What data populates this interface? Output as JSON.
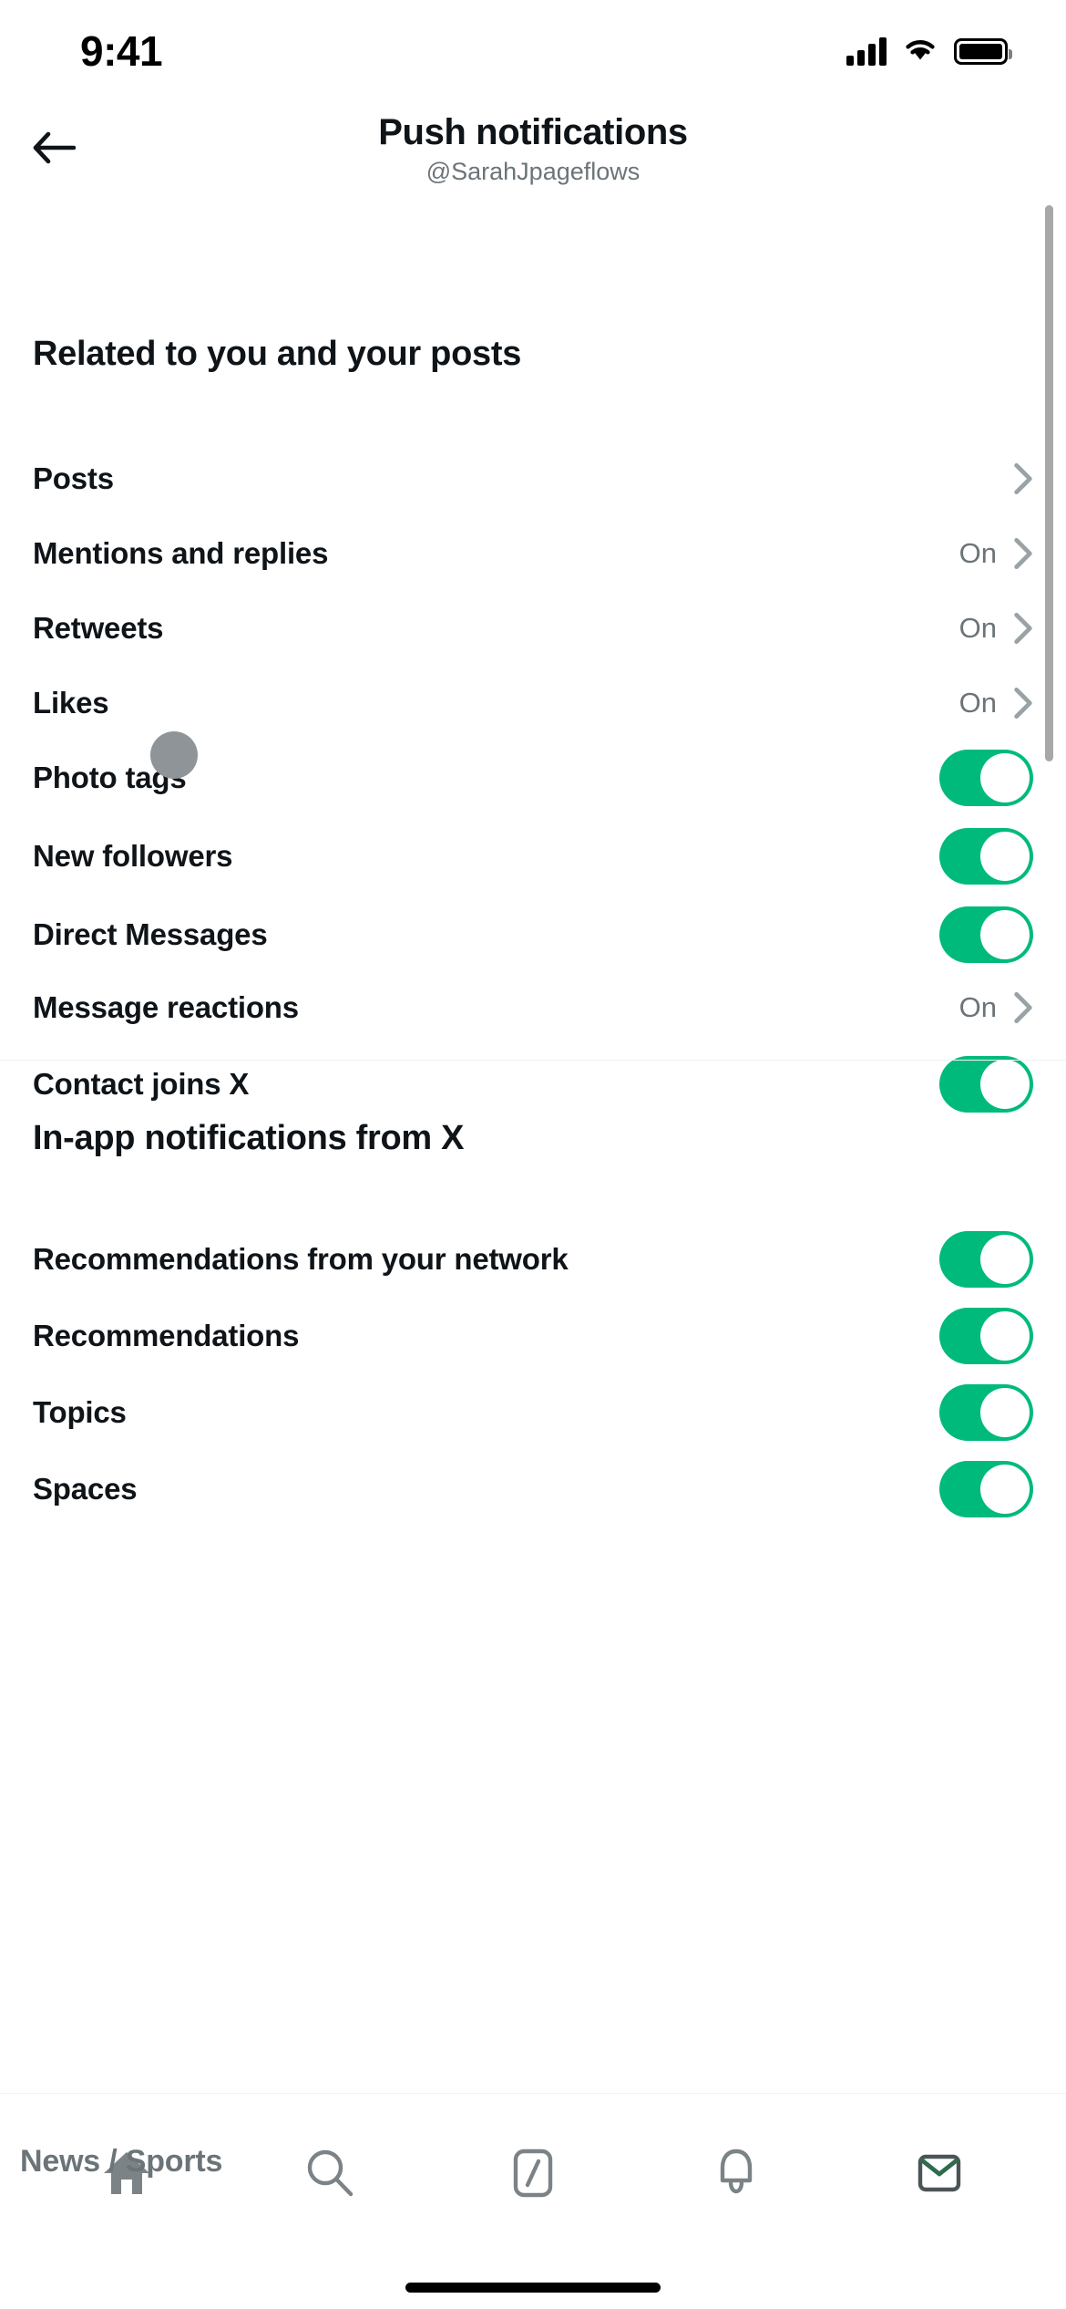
{
  "status_bar": {
    "time": "9:41",
    "signal_icon": "cellular-signal-icon",
    "wifi_icon": "wifi-icon",
    "battery_icon": "battery-full-icon"
  },
  "header": {
    "back_icon": "back-arrow-icon",
    "title": "Push notifications",
    "subtitle": "@SarahJpageflows"
  },
  "sections": [
    {
      "heading": "Related to you and your posts",
      "rows": [
        {
          "label": "Posts",
          "type": "link",
          "value": "",
          "chevron_icon": "chevron-right-icon"
        },
        {
          "label": "Mentions and replies",
          "type": "link",
          "value": "On",
          "chevron_icon": "chevron-right-icon"
        },
        {
          "label": "Retweets",
          "type": "link",
          "value": "On",
          "chevron_icon": "chevron-right-icon"
        },
        {
          "label": "Likes",
          "type": "link",
          "value": "On",
          "chevron_icon": "chevron-right-icon"
        },
        {
          "label": "Photo tags",
          "type": "toggle",
          "state": "on"
        },
        {
          "label": "New followers",
          "type": "toggle",
          "state": "on"
        },
        {
          "label": "Direct Messages",
          "type": "toggle",
          "state": "on"
        },
        {
          "label": "Message reactions",
          "type": "link",
          "value": "On",
          "chevron_icon": "chevron-right-icon"
        },
        {
          "label": "Contact joins X",
          "type": "toggle",
          "state": "on"
        }
      ]
    },
    {
      "heading": "In-app notifications from X",
      "rows": [
        {
          "label": "Recommendations from your network",
          "type": "toggle",
          "state": "on"
        },
        {
          "label": "Recommendations",
          "type": "toggle",
          "state": "on"
        },
        {
          "label": "Topics",
          "type": "toggle",
          "state": "on"
        },
        {
          "label": "Spaces",
          "type": "toggle",
          "state": "on"
        }
      ]
    }
  ],
  "overlay": {
    "label": "News / Sports"
  },
  "tab_bar": {
    "tabs": [
      {
        "name": "home-icon",
        "label": "Home"
      },
      {
        "name": "search-icon",
        "label": "Search"
      },
      {
        "name": "grok-icon",
        "label": "Grok"
      },
      {
        "name": "bell-icon",
        "label": "Notifications"
      },
      {
        "name": "messages-icon",
        "label": "Messages"
      }
    ]
  },
  "colors": {
    "toggle_on": "#00ba7c",
    "toggle_off": "#c4cbd0",
    "text_primary": "#0f1419",
    "text_secondary": "#6b7478",
    "divider": "#eff3f4",
    "cursor": "#8e9497"
  }
}
